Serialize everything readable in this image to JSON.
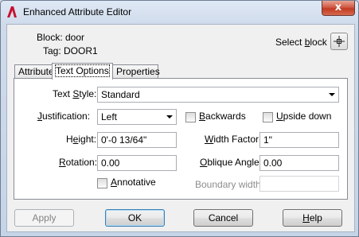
{
  "window": {
    "title": "Enhanced Attribute Editor",
    "close_glyph": "x"
  },
  "header": {
    "block_label": "Block: door",
    "tag_label": "Tag: DOOR1",
    "select_block": {
      "pre": "Select ",
      "underline": "b",
      "post": "lock"
    }
  },
  "tabs": [
    {
      "label": "Attribute"
    },
    {
      "label": "Text Options"
    },
    {
      "label": "Properties"
    }
  ],
  "form": {
    "text_style": {
      "pre": "Text ",
      "underline": "S",
      "post": "tyle:",
      "value": "Standard"
    },
    "justification": {
      "pre": "",
      "underline": "J",
      "post": "ustification:",
      "value": "Left"
    },
    "backwards": {
      "pre": "",
      "underline": "B",
      "post": "ackwards",
      "checked": false
    },
    "upside_down": {
      "pre": "",
      "underline": "U",
      "post": "pside down",
      "checked": false
    },
    "height": {
      "pre": "H",
      "underline": "e",
      "post": "ight:",
      "value": "0'-0 13/64\""
    },
    "width_factor": {
      "pre": "",
      "underline": "W",
      "post": "idth Factor:",
      "value": "1\""
    },
    "rotation": {
      "pre": "",
      "underline": "R",
      "post": "otation:",
      "value": "0.00"
    },
    "oblique_angle": {
      "pre": "",
      "underline": "O",
      "post": "blique Angle:",
      "value": "0.00"
    },
    "annotative": {
      "pre": "",
      "underline": "A",
      "post": "nnotative",
      "checked": false
    },
    "boundary_width": {
      "label": "Boundary width:",
      "value": ""
    }
  },
  "buttons": {
    "apply": "Apply",
    "ok": "OK",
    "cancel": "Cancel",
    "help": {
      "pre": "",
      "underline": "H",
      "post": "elp"
    }
  }
}
